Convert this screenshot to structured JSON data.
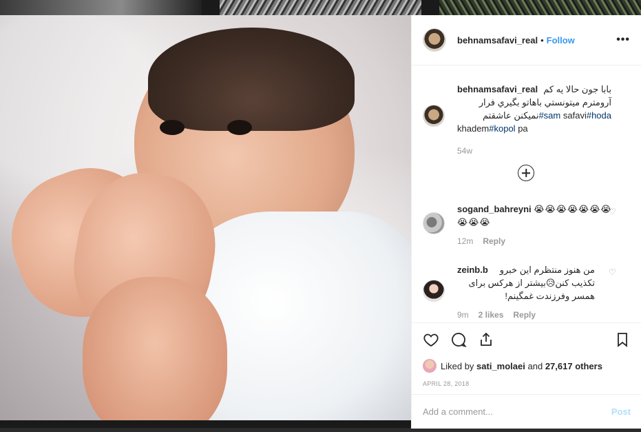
{
  "post": {
    "author": "behnamsafavi_real",
    "dot": "•",
    "follow_label": "Follow",
    "more_label": "•••"
  },
  "caption": {
    "username": "behnamsafavi_real",
    "line1_rtl": "بابا جون حالا یه کم",
    "line2_rtl": "آرومترم میتونستي باهاتو بگيري فرار",
    "tag_sam": "#sam",
    "line3_rtl": "نمیکنن عاشقتم",
    "safavi": "safavi",
    "tag_hoda": "#hoda",
    "khadem": "khadem",
    "tag_kopol": "#kopol",
    "pa": "pa",
    "time": "54w"
  },
  "comments": [
    {
      "username": "sogand_bahreyni",
      "text": "😭😭😭😭😭😭😭😭😭😭",
      "time": "12m",
      "reply_label": "Reply"
    },
    {
      "username": "zeinb.b",
      "line1_rtl": "من هنوز منتظرم این خبرو",
      "line2_rtl": "تکذیب کنن😥بیشتر از هرکس برای",
      "line3_rtl": "همسر وفرزندت غمگینم!",
      "time": "9m",
      "likes": "2 likes",
      "reply_label": "Reply"
    }
  ],
  "actions": {
    "liked_by_prefix": "Liked by",
    "liked_by_user": "sati_molaei",
    "liked_and": "and",
    "liked_count": "27,617 others",
    "date": "April 28, 2018"
  },
  "add_comment": {
    "placeholder": "Add a comment...",
    "post_label": "Post"
  },
  "icons": [
    "heart-icon",
    "comment-icon",
    "share-icon",
    "bookmark-icon",
    "plus-circle-icon",
    "more-icon"
  ]
}
